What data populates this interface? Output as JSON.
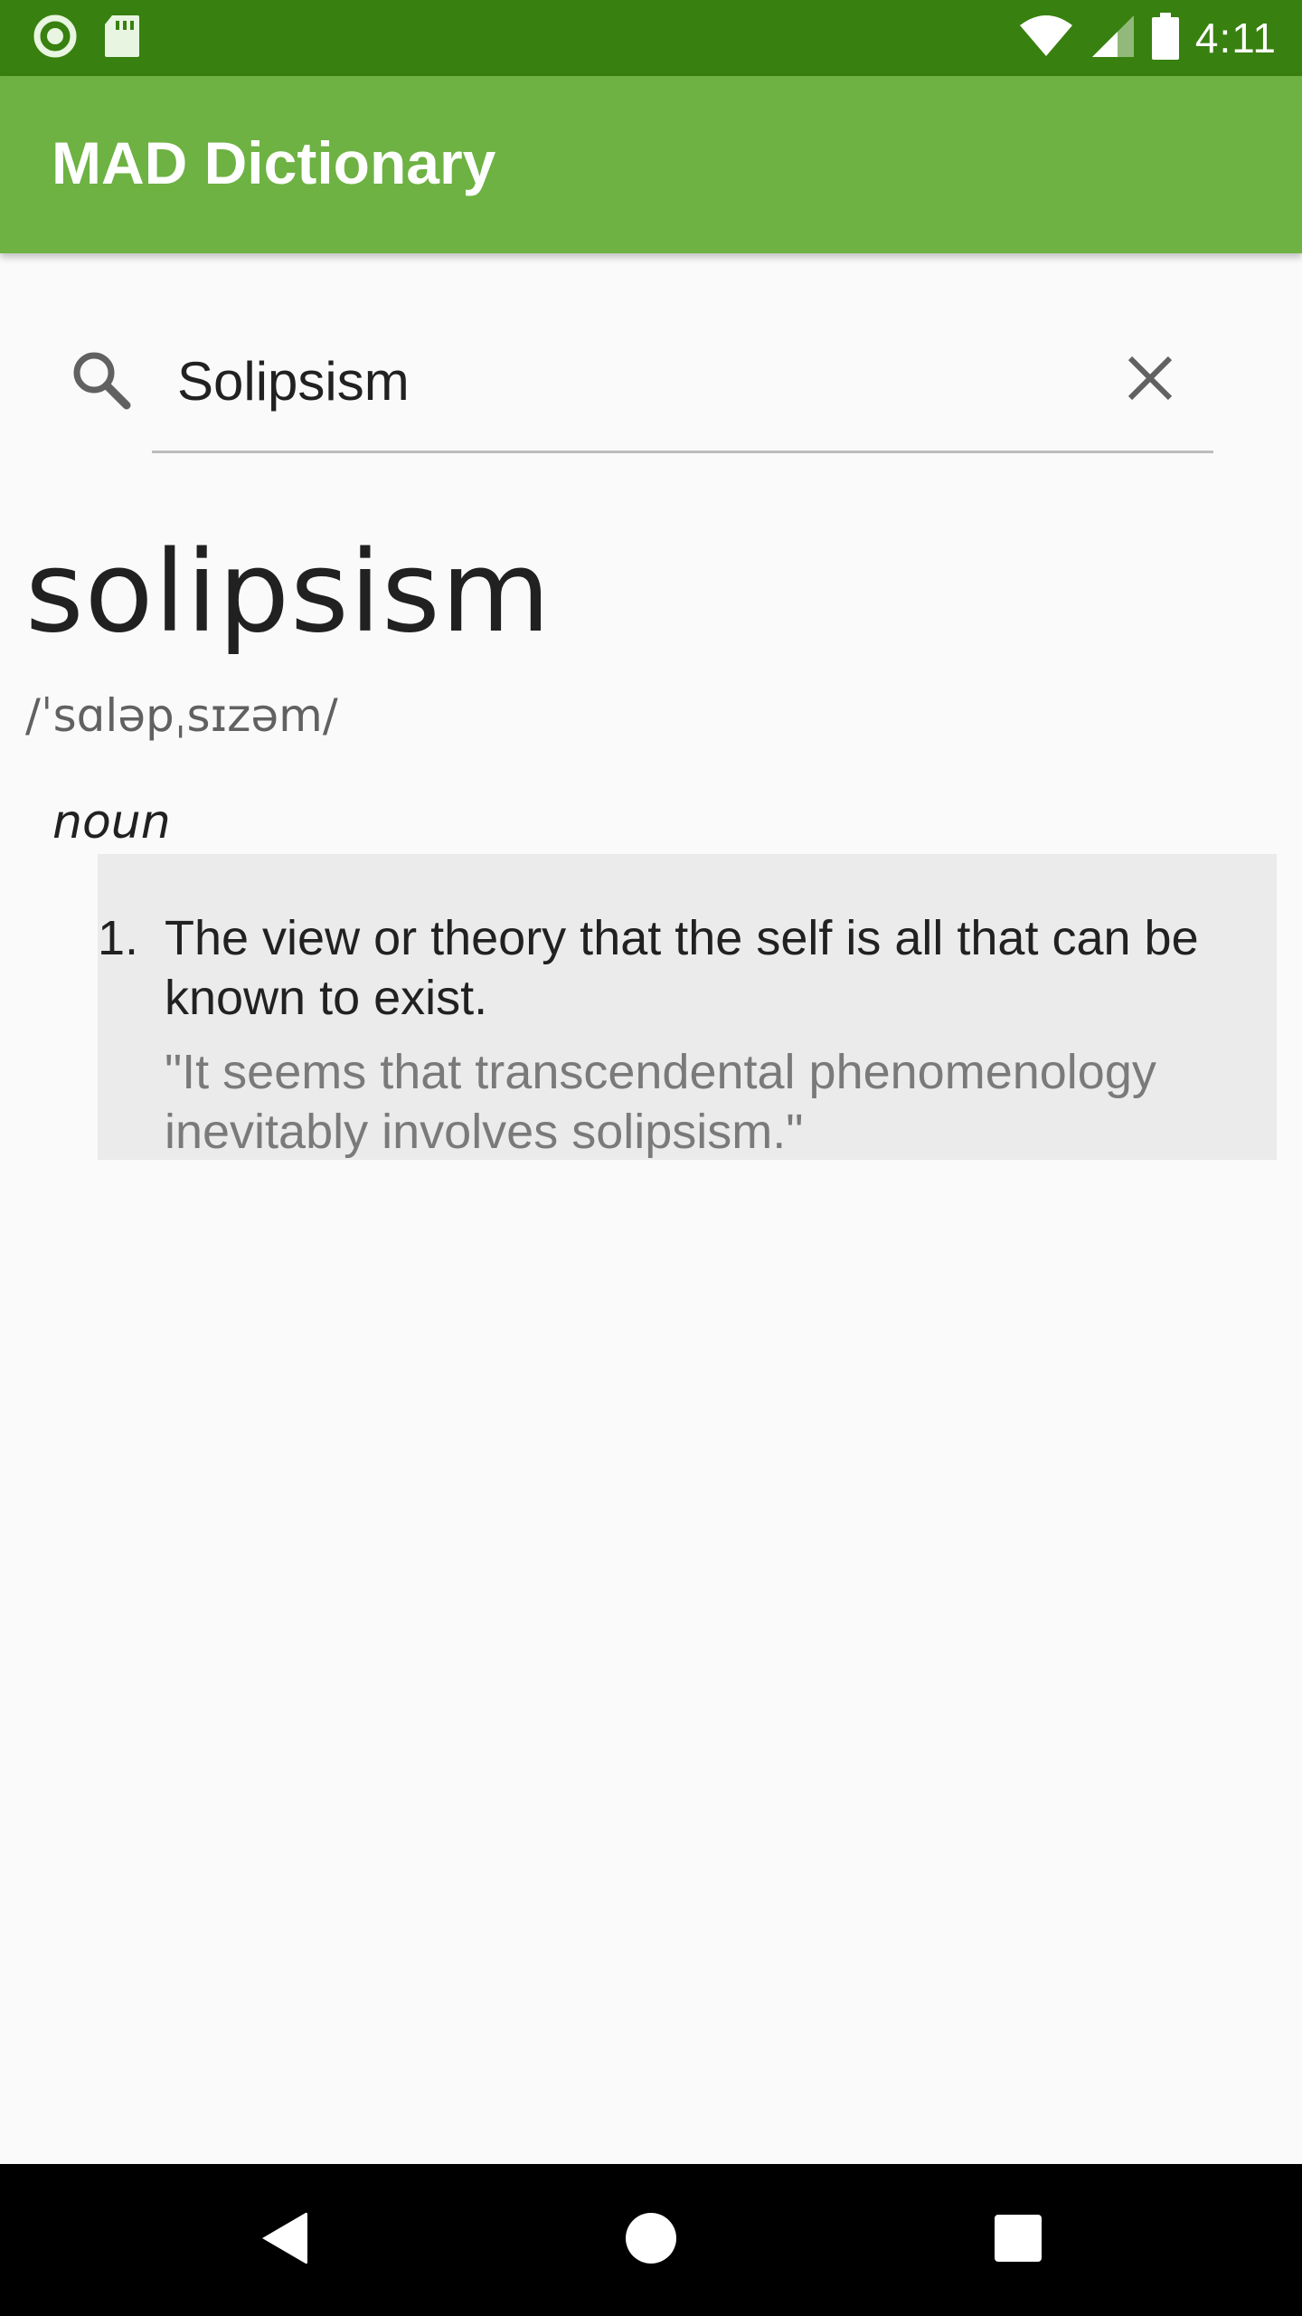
{
  "status_bar": {
    "time": "4:11",
    "icons": [
      "sync-icon",
      "sd-card-icon",
      "wifi-icon",
      "cell-signal-icon",
      "battery-icon"
    ],
    "background": "#38800f"
  },
  "app_bar": {
    "title": "MAD Dictionary",
    "background": "#6db243"
  },
  "search": {
    "value": "Solipsism",
    "icon": "search-icon",
    "clear_icon": "close-icon"
  },
  "entry": {
    "word": "solipsism",
    "phonetic": "/ˈsɑləpˌsɪzəm/",
    "part_of_speech": "noun",
    "definitions": [
      {
        "number": "1.",
        "text": "The view or theory that the self is all that can be known to exist.",
        "example": "\"It seems that transcendental phenomenology inevitably involves solipsism.\""
      }
    ]
  },
  "nav_bar": {
    "buttons": [
      "back-icon",
      "home-icon",
      "recents-icon"
    ]
  }
}
